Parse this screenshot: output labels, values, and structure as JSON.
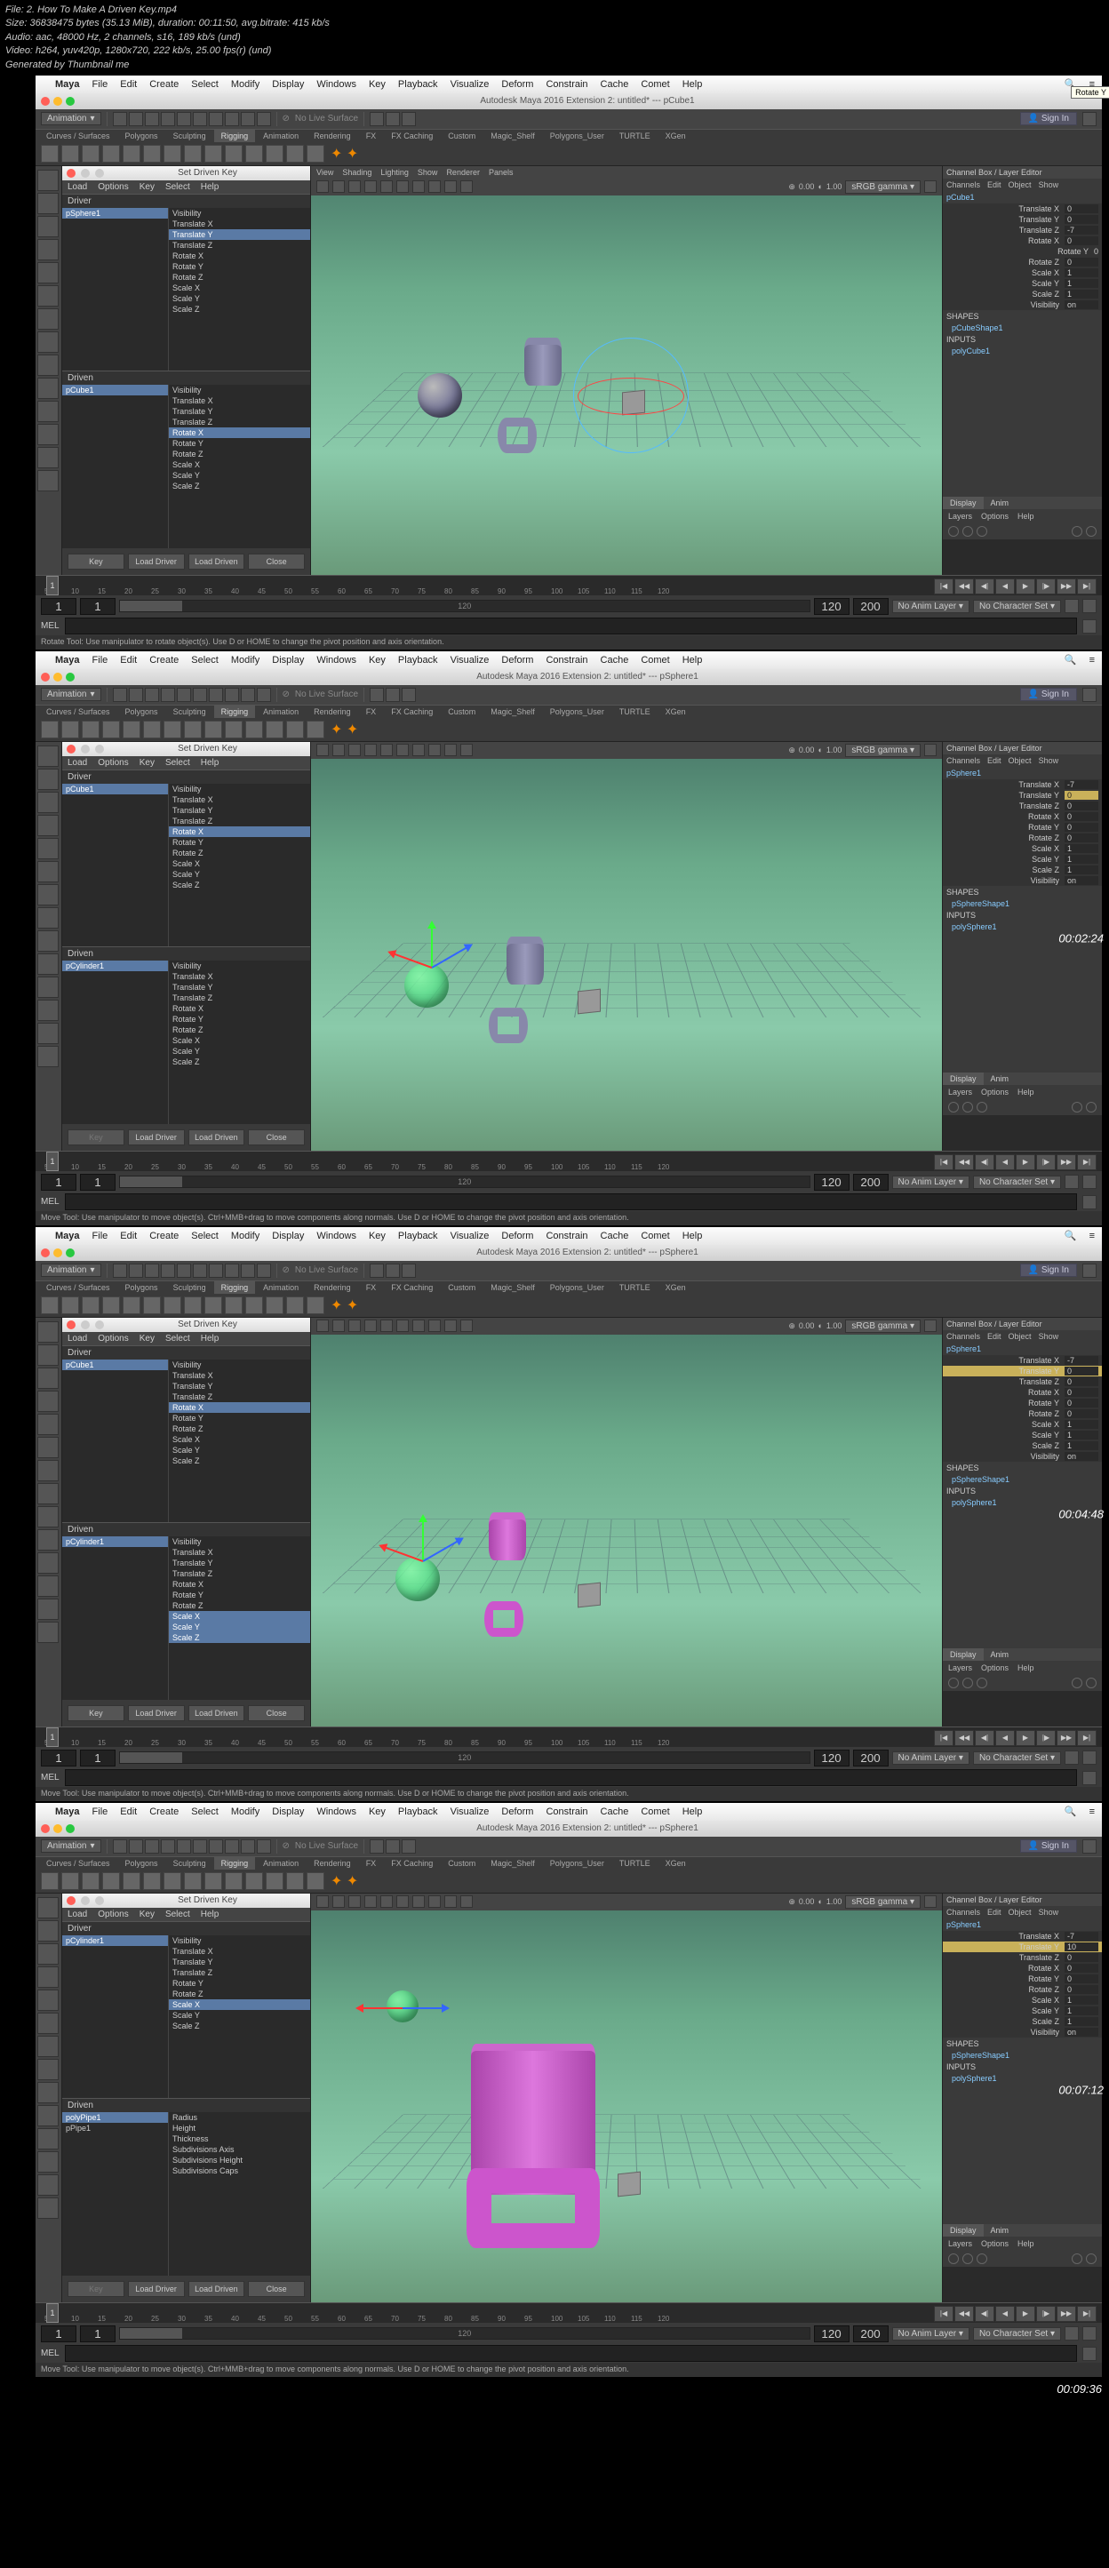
{
  "file_info": {
    "file": "File: 2. How To Make A Driven Key.mp4",
    "size": "Size: 36838475 bytes (35.13 MiB), duration: 00:11:50, avg.bitrate: 415 kb/s",
    "audio": "Audio: aac, 48000 Hz, 2 channels, s16, 189 kb/s (und)",
    "video": "Video: h264, yuv420p, 1280x720, 222 kb/s, 25.00 fps(r) (und)",
    "gen": "Generated by Thumbnail me"
  },
  "mac_menu": {
    "app": "Maya",
    "items": [
      "File",
      "Edit",
      "Create",
      "Select",
      "Modify",
      "Display",
      "Windows",
      "Key",
      "Playback",
      "Visualize",
      "Deform",
      "Constrain",
      "Cache",
      "Comet",
      "Help"
    ]
  },
  "module_dd": "Animation",
  "shelf_tabs": [
    "Curves / Surfaces",
    "Polygons",
    "Sculpting",
    "Rigging",
    "Animation",
    "Rendering",
    "FX",
    "FX Caching",
    "Custom",
    "Magic_Shelf",
    "Polygons_User",
    "TURTLE",
    "XGen"
  ],
  "active_shelf": "Rigging",
  "nolive": "No Live Surface",
  "signin": "Sign In",
  "sdk": {
    "title": "Set Driven Key",
    "menu": [
      "Load",
      "Options",
      "Key",
      "Select",
      "Help"
    ],
    "driver": "Driver",
    "driven": "Driven",
    "btns": [
      "Key",
      "Load Driver",
      "Load Driven",
      "Close"
    ]
  },
  "attrs_full": [
    "Visibility",
    "Translate X",
    "Translate Y",
    "Translate Z",
    "Rotate X",
    "Rotate Y",
    "Rotate Z",
    "Scale X",
    "Scale Y",
    "Scale Z"
  ],
  "attrs_pipe": [
    "Radius",
    "Height",
    "Thickness",
    "Subdivisions Axis",
    "Subdivisions Height",
    "Subdivisions Caps"
  ],
  "cb": {
    "title": "Channel Box / Layer Editor",
    "menu": [
      "Channels",
      "Edit",
      "Object",
      "Show"
    ],
    "shapes": "SHAPES",
    "inputs": "INPUTS",
    "display": "Display",
    "anim": "Anim",
    "layers": "Layers",
    "options": "Options",
    "help": "Help"
  },
  "vp_menu": [
    "View",
    "Shading",
    "Lighting",
    "Show",
    "Renderer",
    "Panels"
  ],
  "srgb": "sRGB gamma",
  "timeline": {
    "frame": "1",
    "start": "1",
    "slider_mid": "120",
    "range_end": "120",
    "end": "200",
    "noanim": "No Anim Layer",
    "nochar": "No Character Set",
    "marks": [
      "5",
      "10",
      "15",
      "20",
      "25",
      "30",
      "35",
      "40",
      "45",
      "50",
      "55",
      "60",
      "65",
      "70",
      "75",
      "80",
      "85",
      "90",
      "95",
      "100",
      "105",
      "110",
      "115",
      "120"
    ]
  },
  "mel": "MEL",
  "frames": [
    {
      "timestamp": "00:02:24",
      "title": "Autodesk Maya 2016 Extension 2: untitled*  ---  pCube1",
      "help": "Rotate Tool: Use manipulator to rotate object(s). Use D or HOME to change the pivot position and axis orientation.",
      "sdk_driver_obj": "pSphere1",
      "sdk_driver_sel": "Translate Y",
      "sdk_driven_obj": "pCube1",
      "sdk_driven_sel": "Rotate X",
      "sdk_key_off": false,
      "cb_obj": "pCube1",
      "cb_channels": [
        {
          "n": "Translate X",
          "v": "0"
        },
        {
          "n": "Translate Y",
          "v": "0"
        },
        {
          "n": "Translate Z",
          "v": "-7"
        },
        {
          "n": "Rotate X",
          "v": "0"
        },
        {
          "n": "Rotate Y",
          "v": "0",
          "hl": true,
          "tip": "Rotate Y"
        },
        {
          "n": "Rotate Z",
          "v": "0"
        },
        {
          "n": "Scale X",
          "v": "1"
        },
        {
          "n": "Scale Y",
          "v": "1"
        },
        {
          "n": "Scale Z",
          "v": "1"
        },
        {
          "n": "Visibility",
          "v": "on"
        }
      ],
      "cb_shape": "pCubeShape1",
      "cb_input": "polyCube1",
      "scene": "rotate"
    },
    {
      "timestamp": "00:04:48",
      "title": "Autodesk Maya 2016 Extension 2: untitled*  ---  pSphere1",
      "help": "Move Tool: Use manipulator to move object(s). Ctrl+MMB+drag to move components along normals. Use D or HOME to change the pivot position and axis orientation.",
      "sdk_driver_obj": "pCube1",
      "sdk_driver_sel": "Rotate X",
      "sdk_driven_obj": "pCylinder1",
      "sdk_driven_sel": "",
      "sdk_key_off": true,
      "cb_obj": "pSphere1",
      "cb_channels": [
        {
          "n": "Translate X",
          "v": "-7"
        },
        {
          "n": "Translate Y",
          "v": "0",
          "hl": true
        },
        {
          "n": "Translate Z",
          "v": "0"
        },
        {
          "n": "Rotate X",
          "v": "0"
        },
        {
          "n": "Rotate Y",
          "v": "0"
        },
        {
          "n": "Rotate Z",
          "v": "0"
        },
        {
          "n": "Scale X",
          "v": "1"
        },
        {
          "n": "Scale Y",
          "v": "1"
        },
        {
          "n": "Scale Z",
          "v": "1"
        },
        {
          "n": "Visibility",
          "v": "on"
        }
      ],
      "cb_shape": "pSphereShape1",
      "cb_input": "polySphere1",
      "scene": "move"
    },
    {
      "timestamp": "00:07:12",
      "title": "Autodesk Maya 2016 Extension 2: untitled*  ---  pSphere1",
      "help": "Move Tool: Use manipulator to move object(s). Ctrl+MMB+drag to move components along normals. Use D or HOME to change the pivot position and axis orientation.",
      "sdk_driver_obj": "pCube1",
      "sdk_driver_sel": "Rotate X",
      "sdk_driven_obj": "pCylinder1",
      "sdk_driven_sel": "Scale X,Scale Y,Scale Z",
      "sdk_key_off": false,
      "cb_obj": "pSphere1",
      "cb_channels": [
        {
          "n": "Translate X",
          "v": "-7"
        },
        {
          "n": "Translate Y",
          "v": "0",
          "hlfull": true
        },
        {
          "n": "Translate Z",
          "v": "0"
        },
        {
          "n": "Rotate X",
          "v": "0"
        },
        {
          "n": "Rotate Y",
          "v": "0"
        },
        {
          "n": "Rotate Z",
          "v": "0"
        },
        {
          "n": "Scale X",
          "v": "1"
        },
        {
          "n": "Scale Y",
          "v": "1"
        },
        {
          "n": "Scale Z",
          "v": "1"
        },
        {
          "n": "Visibility",
          "v": "on"
        }
      ],
      "cb_shape": "pSphereShape1",
      "cb_input": "polySphere1",
      "scene": "move_mag"
    },
    {
      "timestamp": "00:09:36",
      "title": "Autodesk Maya 2016 Extension 2: untitled*  ---  pSphere1",
      "help": "Move Tool: Use manipulator to move object(s). Ctrl+MMB+drag to move components along normals. Use D or HOME to change the pivot position and axis orientation.",
      "sdk_driver_obj": "pCylinder1",
      "sdk_driver_sel": "Scale X",
      "sdk_driver_attrs_short": [
        "Visibility",
        "Translate X",
        "Translate Y",
        "Translate Z",
        "Rotate Y",
        "Rotate Z",
        "Scale X",
        "Scale Y",
        "Scale Z"
      ],
      "sdk_driven_obj": "polyPipe1",
      "sdk_driven_obj2": "pPipe1",
      "sdk_driven_sel": "",
      "sdk_driven_attrs": "pipe",
      "sdk_key_off": true,
      "cb_obj": "pSphere1",
      "cb_channels": [
        {
          "n": "Translate X",
          "v": "-7"
        },
        {
          "n": "Translate Y",
          "v": "10",
          "hlfull": true
        },
        {
          "n": "Translate Z",
          "v": "0"
        },
        {
          "n": "Rotate X",
          "v": "0"
        },
        {
          "n": "Rotate Y",
          "v": "0"
        },
        {
          "n": "Rotate Z",
          "v": "0"
        },
        {
          "n": "Scale X",
          "v": "1"
        },
        {
          "n": "Scale Y",
          "v": "1"
        },
        {
          "n": "Scale Z",
          "v": "1"
        },
        {
          "n": "Visibility",
          "v": "on"
        }
      ],
      "cb_shape": "pSphereShape1",
      "cb_input": "polySphere1",
      "scene": "big"
    }
  ],
  "vp_toolbar_vals": {
    "zero": "0.00",
    "one": "1.00"
  },
  "end_ts": "00:09:36"
}
